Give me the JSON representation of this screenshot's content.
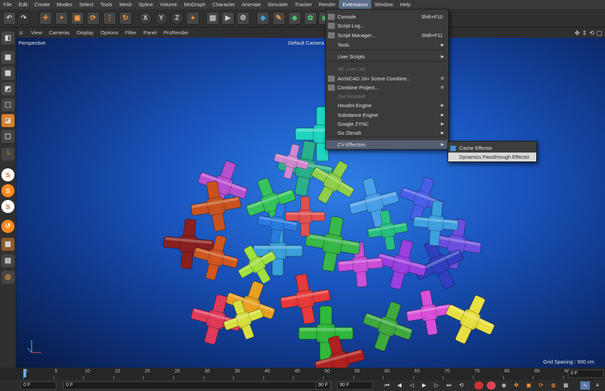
{
  "menubar": {
    "items": [
      "File",
      "Edit",
      "Create",
      "Modes",
      "Select",
      "Tools",
      "Mesh",
      "Spline",
      "Volume",
      "MoGraph",
      "Character",
      "Animate",
      "Simulate",
      "Tracker",
      "Render",
      "Extensions",
      "Window",
      "Help"
    ],
    "active": "Extensions"
  },
  "viewport_menu": {
    "items": [
      "View",
      "Cameras",
      "Display",
      "Options",
      "Filter",
      "Panel",
      "ProRender"
    ]
  },
  "viewport": {
    "view_name": "Perspective",
    "camera_name": "Default Camera",
    "grid_spacing": "Grid Spacing : 500 cm",
    "background_color": "#1f5fd0"
  },
  "extensions_menu": {
    "items": [
      {
        "label": "Console",
        "shortcut": "Shift+F10",
        "icon": "console-icon"
      },
      {
        "label": "Script Log...",
        "icon": "script-log-icon"
      },
      {
        "label": "Script Manager...",
        "shortcut": "Shift+F11",
        "icon": "script-manager-icon"
      },
      {
        "label": "Tools",
        "submenu": true
      },
      {
        "label": "User Scripts",
        "submenu": true
      },
      {
        "label": "AE Live Link",
        "disabled": true
      },
      {
        "label": "ArchiCAD 16+ Scene Combine...",
        "icon": "archicad-icon",
        "gear": true
      },
      {
        "label": "Combine Project...",
        "icon": "combine-icon",
        "gear": true
      },
      {
        "label": "Get Redshift",
        "disabled": true
      },
      {
        "label": "Houdini Engine",
        "submenu": true
      },
      {
        "label": "Substance Engine",
        "submenu": true
      },
      {
        "label": "Google ZYNC",
        "submenu": true
      },
      {
        "label": "Go Zbrush",
        "submenu": true
      },
      {
        "label": "CV-Effectors",
        "submenu": true,
        "highlighted": true
      }
    ]
  },
  "cv_effectors_submenu": {
    "items": [
      {
        "label": "Cache Effector"
      },
      {
        "label": "Dynamics Passthrough Effector",
        "highlighted": true
      }
    ]
  },
  "timeline": {
    "ticks": [
      "0",
      "5",
      "10",
      "15",
      "20",
      "25",
      "30",
      "35",
      "40",
      "45",
      "50",
      "55",
      "60",
      "65",
      "70",
      "75",
      "80",
      "85",
      "90"
    ],
    "current_frame": "0 F"
  },
  "transport": {
    "start_field": "0 F",
    "current_field": "0 F",
    "end_field_a": "90 F",
    "end_field_b": "90 F",
    "right_field": "0 F"
  },
  "colors": {
    "accent": "#ff8a1e",
    "menu_highlight": "#535f71",
    "viewport_bg": "#1f5fd0"
  }
}
